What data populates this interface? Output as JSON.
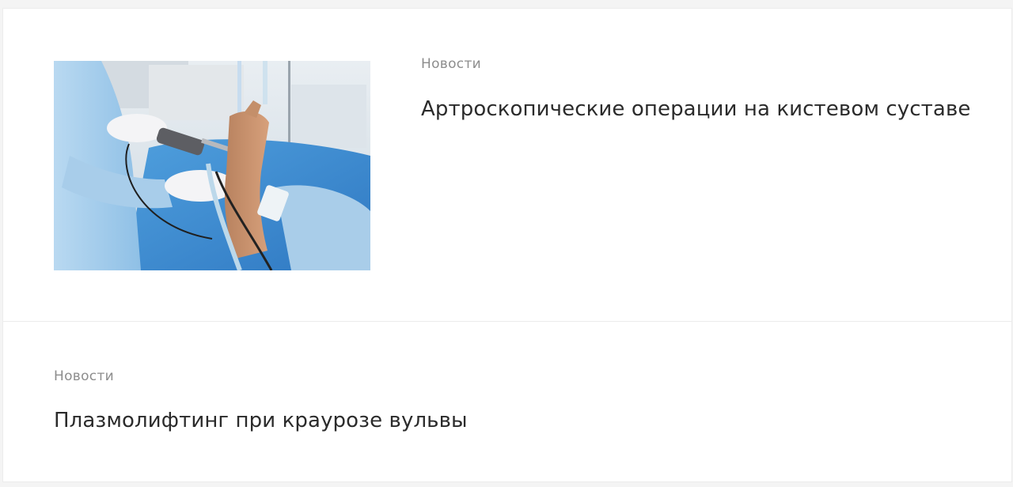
{
  "news_feed": {
    "items": [
      {
        "category": "Новости",
        "title": "Артроскопические операции на кистевом суставе",
        "image_alt": "arthroscopic-wrist-surgery-photo"
      },
      {
        "category": "Новости",
        "title": "Плазмолифтинг при краурозе вульвы"
      }
    ]
  }
}
